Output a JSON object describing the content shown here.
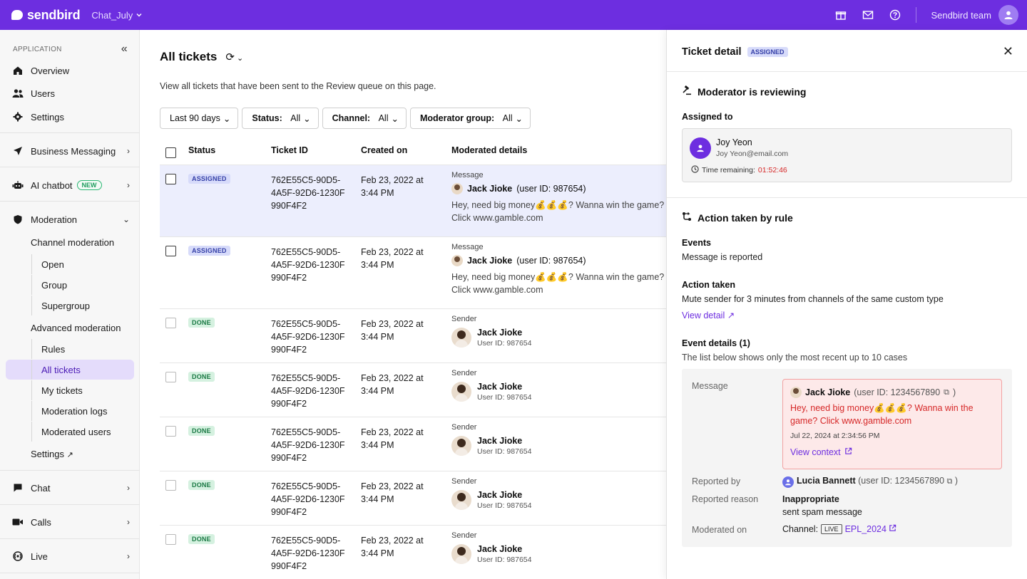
{
  "topbar": {
    "brand": "sendbird",
    "app_name": "Chat_July",
    "team_name": "Sendbird team"
  },
  "sidebar": {
    "section_label": "APPLICATION",
    "items": {
      "overview": "Overview",
      "users": "Users",
      "settings": "Settings",
      "business_messaging": "Business Messaging",
      "ai_chatbot": "AI chatbot",
      "ai_chatbot_badge": "NEW",
      "moderation": "Moderation",
      "channel_moderation": "Channel moderation",
      "open": "Open",
      "group": "Group",
      "supergroup": "Supergroup",
      "advanced_moderation": "Advanced moderation",
      "rules": "Rules",
      "all_tickets": "All tickets",
      "my_tickets": "My tickets",
      "moderation_logs": "Moderation logs",
      "moderated_users": "Moderated users",
      "mod_settings": "Settings",
      "chat": "Chat",
      "calls": "Calls",
      "live": "Live"
    }
  },
  "main": {
    "title": "All tickets",
    "description": "View all tickets that have been sent to the Review queue on this page.",
    "filters": {
      "date": "Last 90 days",
      "status_label": "Status:",
      "status_value": "All",
      "channel_label": "Channel:",
      "channel_value": "All",
      "group_label": "Moderator group:",
      "group_value": "All"
    },
    "columns": {
      "status": "Status",
      "ticket_id": "Ticket ID",
      "created_on": "Created on",
      "details": "Moderated details"
    },
    "rows": [
      {
        "status": "ASSIGNED",
        "id1": "762E55C5-90D5-",
        "id2": "4A5F-92D6-1230F",
        "id3": "990F4F2",
        "date1": "Feb 23, 2022 at",
        "date2": "3:44 PM",
        "kind": "Message",
        "user_name": "Jack Jioke",
        "user_id": "(user ID: 987654)",
        "text1": "Hey, need big money💰💰💰? Wanna win the game?",
        "text2": "Click www.gamble.com"
      },
      {
        "status": "ASSIGNED",
        "id1": "762E55C5-90D5-",
        "id2": "4A5F-92D6-1230F",
        "id3": "990F4F2",
        "date1": "Feb 23, 2022 at",
        "date2": "3:44 PM",
        "kind": "Message",
        "user_name": "Jack Jioke",
        "user_id": "(user ID: 987654)",
        "text1": "Hey, need big money💰💰💰? Wanna win the game?",
        "text2": "Click www.gamble.com"
      },
      {
        "status": "DONE",
        "id1": "762E55C5-90D5-",
        "id2": "4A5F-92D6-1230F",
        "id3": "990F4F2",
        "date1": "Feb 23, 2022 at",
        "date2": "3:44 PM",
        "kind": "Sender",
        "user_name": "Jack Jioke",
        "user_id": "User ID: 987654"
      },
      {
        "status": "DONE",
        "id1": "762E55C5-90D5-",
        "id2": "4A5F-92D6-1230F",
        "id3": "990F4F2",
        "date1": "Feb 23, 2022 at",
        "date2": "3:44 PM",
        "kind": "Sender",
        "user_name": "Jack Jioke",
        "user_id": "User ID: 987654"
      },
      {
        "status": "DONE",
        "id1": "762E55C5-90D5-",
        "id2": "4A5F-92D6-1230F",
        "id3": "990F4F2",
        "date1": "Feb 23, 2022 at",
        "date2": "3:44 PM",
        "kind": "Sender",
        "user_name": "Jack Jioke",
        "user_id": "User ID: 987654"
      },
      {
        "status": "DONE",
        "id1": "762E55C5-90D5-",
        "id2": "4A5F-92D6-1230F",
        "id3": "990F4F2",
        "date1": "Feb 23, 2022 at",
        "date2": "3:44 PM",
        "kind": "Sender",
        "user_name": "Jack Jioke",
        "user_id": "User ID: 987654"
      },
      {
        "status": "DONE",
        "id1": "762E55C5-90D5-",
        "id2": "4A5F-92D6-1230F",
        "id3": "990F4F2",
        "date1": "Feb 23, 2022 at",
        "date2": "3:44 PM",
        "kind": "Sender",
        "user_name": "Jack Jioke",
        "user_id": "User ID: 987654"
      }
    ]
  },
  "panel": {
    "title": "Ticket detail",
    "badge": "ASSIGNED",
    "reviewing": "Moderator is reviewing",
    "assigned_to_label": "Assigned to",
    "assignee_name": "Joy Yeon",
    "assignee_email": "Joy Yeon@email.com",
    "time_label": "Time remaining:",
    "time_value": "01:52:46",
    "action_rule_title": "Action taken by rule",
    "events_label": "Events",
    "events_value": "Message is reported",
    "action_label": "Action taken",
    "action_value": "Mute sender for 3 minutes from channels of the same custom type",
    "view_detail": "View detail",
    "event_details_label": "Event details (1)",
    "event_details_desc": "The list below shows only the most recent up to 10 cases",
    "ev_message_label": "Message",
    "ev_user_name": "Jack Jioke",
    "ev_user_id": "(user ID: 1234567890",
    "ev_user_id_close": ")",
    "ev_text": "Hey, need big money💰💰💰? Wanna win the game? Click www.gamble.com",
    "ev_time": "Jul 22, 2024 at 2:34:56 PM",
    "ev_view_context": "View context",
    "reported_by_label": "Reported by",
    "reporter_name": "Lucia Bannett",
    "reporter_id": "(user ID: 1234567890",
    "reporter_id_close": ")",
    "reported_reason_label": "Reported reason",
    "reason_title": "Inappropriate",
    "reason_desc": "sent spam message",
    "moderated_on_label": "Moderated on",
    "channel_label": "Channel:",
    "live_tag": "LIVE",
    "channel_name": "EPL_2024"
  }
}
